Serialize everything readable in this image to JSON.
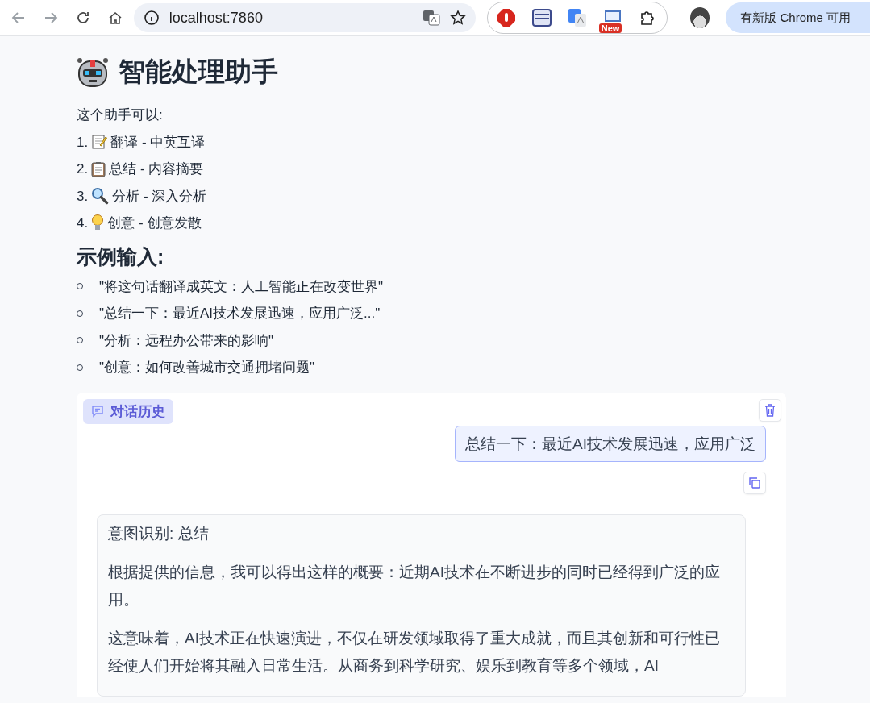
{
  "browser": {
    "address": "localhost:7860",
    "extension_badge": "New",
    "update_button": "有新版 Chrome 可用"
  },
  "page": {
    "title": "智能处理助手",
    "intro": "这个助手可以:",
    "capabilities": [
      {
        "number": "1.",
        "text": "翻译 - 中英互译"
      },
      {
        "number": "2.",
        "text": "总结 - 内容摘要"
      },
      {
        "number": "3.",
        "text": "分析 - 深入分析"
      },
      {
        "number": "4.",
        "text": "创意 - 创意发散"
      }
    ],
    "examples_heading": "示例输入:",
    "examples": [
      "\"将这句话翻译成英文：人工智能正在改变世界\"",
      "\"总结一下：最近AI技术发展迅速，应用广泛...\"",
      "\"分析：远程办公带来的影响\"",
      "\"创意：如何改善城市交通拥堵问题\""
    ]
  },
  "chat": {
    "label": "对话历史",
    "messages": [
      {
        "kind": "user",
        "paragraphs": [
          "总结一下：最近AI技术发展迅速，应用广泛"
        ]
      },
      {
        "kind": "bot",
        "paragraphs": [
          "意图识别: 总结",
          "根据提供的信息，我可以得出这样的概要：近期AI技术在不断进步的同时已经得到广泛的应用。",
          "这意味着，AI技术正在快速演进，不仅在研发领域取得了重大成就，而且其创新和可行性已经使人们开始将其融入日常生活。从商务到科学研究、娱乐到教育等多个领域，AI"
        ]
      }
    ]
  }
}
